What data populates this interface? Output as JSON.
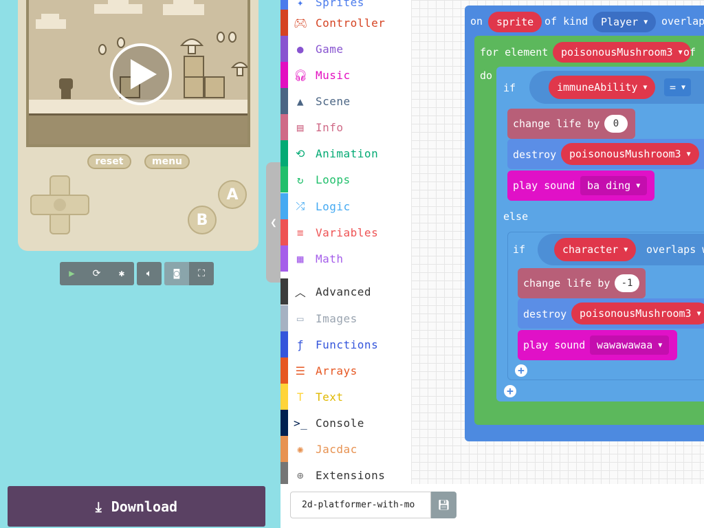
{
  "simulator": {
    "reset_label": "reset",
    "menu_label": "menu",
    "a_label": "A",
    "b_label": "B",
    "toolbar": [
      "play-icon",
      "restart-icon",
      "debug-icon",
      "sound-icon",
      "screenshot-icon",
      "fullscreen-icon"
    ]
  },
  "download": {
    "label": "Download"
  },
  "toolbox": {
    "categories": [
      {
        "label": "Sprites",
        "color": "#4b7bec",
        "icon": "sprite-icon"
      },
      {
        "label": "Controller",
        "color": "#d54322",
        "icon": "gamepad-icon"
      },
      {
        "label": "Game",
        "color": "#8854d0",
        "icon": "circle-icon"
      },
      {
        "label": "Music",
        "color": "#e30fc0",
        "icon": "headphones-icon"
      },
      {
        "label": "Scene",
        "color": "#4b6584",
        "icon": "tree-icon"
      },
      {
        "label": "Info",
        "color": "#cf6a87",
        "icon": "id-card-icon"
      },
      {
        "label": "Animation",
        "color": "#03aa74",
        "icon": "refresh-icon"
      },
      {
        "label": "Loops",
        "color": "#20bf6b",
        "icon": "loop-icon"
      },
      {
        "label": "Logic",
        "color": "#45aaf2",
        "icon": "shuffle-icon"
      },
      {
        "label": "Variables",
        "color": "#ee5253",
        "icon": "list-icon"
      },
      {
        "label": "Math",
        "color": "#a55eea",
        "icon": "calculator-icon"
      },
      {
        "label": "Advanced",
        "color": "#3c3c3c",
        "icon": "chevron-up-icon"
      },
      {
        "label": "Images",
        "color": "#a5b1c2",
        "icon": "image-icon"
      },
      {
        "label": "Functions",
        "color": "#3455db",
        "icon": "function-icon"
      },
      {
        "label": "Arrays",
        "color": "#e65722",
        "icon": "list-ol-icon"
      },
      {
        "label": "Text",
        "color": "#ffd43a",
        "icon": "text-icon"
      },
      {
        "label": "Console",
        "color": "#002050",
        "icon": "terminal-icon"
      },
      {
        "label": "Jacdac",
        "color": "#e79251",
        "icon": "jacdac-icon"
      },
      {
        "label": "Extensions",
        "color": "#757575",
        "icon": "plus-circle-icon"
      }
    ]
  },
  "blocks": {
    "on": "on",
    "sprite": "sprite",
    "of_kind": "of kind",
    "player": "Player",
    "overlaps": "overlap",
    "for_element": "for element",
    "mushroom": "poisonousMushroom3",
    "of": "of",
    "do": "do",
    "if": "if",
    "immune": "immuneAbility",
    "eq": "=",
    "change_life": "change life by",
    "zero": "0",
    "destroy": "destroy",
    "play_sound": "play sound",
    "ba_ding": "ba ding",
    "else": "else",
    "character": "character",
    "overlaps_w": "overlaps w",
    "minus_one": "-1",
    "wawawawaa": "wawawawaa"
  },
  "project": {
    "name": "2d-platformer-with-mo"
  },
  "colors": {
    "events": "#4d8ae0",
    "loops": "#5cb85c",
    "logic": "#5ba5e6",
    "info": "#b85f78",
    "sprites": "#5b8ee6",
    "music": "#e011c7",
    "variables": "#e0374b"
  }
}
